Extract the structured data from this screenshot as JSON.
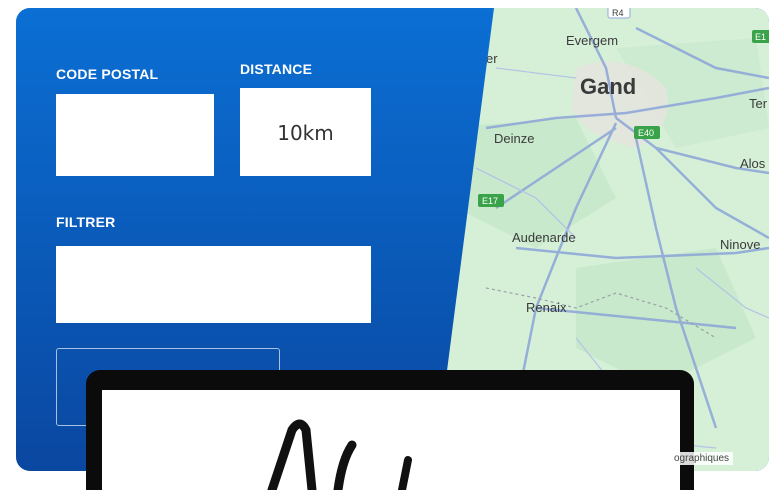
{
  "form": {
    "postal_code_label": "CODE POSTAL",
    "postal_code_value": "",
    "distance_label": "DISTANCE",
    "distance_value": "10km",
    "filter_label": "FILTRER",
    "filter_value": ""
  },
  "map": {
    "places": [
      "Evergem",
      "Gand",
      "Deinze",
      "Audenarde",
      "Renaix",
      "Ninove",
      "Alos",
      "Ter",
      "er"
    ],
    "roads": [
      "R4",
      "E40",
      "E17",
      "E1"
    ],
    "attribution": "ographiques"
  },
  "colors": {
    "panel_top": "#0b6fd4",
    "panel_bottom": "#0a47a0",
    "map_land": "#d6f0d8",
    "road": "#8fa8d8",
    "motorway_badge": "#3aa34a"
  }
}
